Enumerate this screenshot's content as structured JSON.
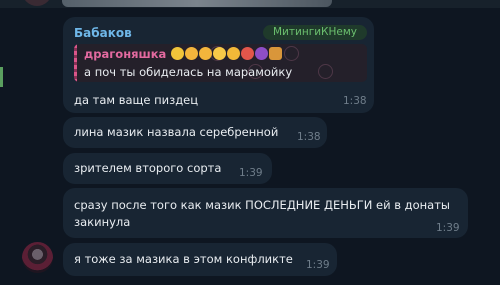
{
  "header": {
    "sender_name": "Бабаков",
    "sender_tag": "МитингиКНему"
  },
  "reply": {
    "author": "драгоняшка",
    "author_emojis": [
      "pray-icon",
      "point-right-icon",
      "point-right-icon",
      "pleading-face-icon",
      "thinking-face-icon",
      "angry-face-icon",
      "devil-icon",
      "beer-icon"
    ],
    "text": "а поч ты обиделась на марамойку"
  },
  "messages": [
    {
      "text": "да там ваще пиздец",
      "time": "1:38"
    },
    {
      "text": "лина мазик назвала серебренной",
      "time": "1:38"
    },
    {
      "text": "зрителем второго сорта",
      "time": "1:39"
    },
    {
      "text_line1": "сразу после того как мазик ПОСЛЕДНИЕ ДЕНЬГИ ей в донаты",
      "text_line2": "закинула",
      "time": "1:39"
    },
    {
      "text": "я тоже за мазика в этом конфликте",
      "time": "1:39"
    }
  ],
  "colors": {
    "background": "#0e1621",
    "bubble": "#182533",
    "sender_name": "#6fb7e8",
    "tag_text": "#6bbf6e",
    "reply_author": "#e36aa0",
    "time": "#6f7d8a"
  }
}
